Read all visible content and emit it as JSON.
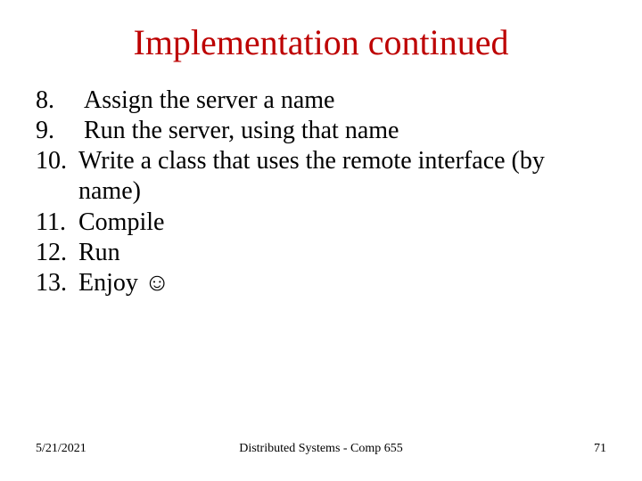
{
  "title": "Implementation continued",
  "items": [
    {
      "n": "8.",
      "text": "Assign the server a name",
      "tight": false
    },
    {
      "n": "9.",
      "text": "Run the server, using that name",
      "tight": false
    },
    {
      "n": "10.",
      "text": "Write a class that uses the remote interface (by name)",
      "tight": true
    },
    {
      "n": "11.",
      "text": "Compile",
      "tight": true
    },
    {
      "n": "12.",
      "text": "Run",
      "tight": true
    },
    {
      "n": "13.",
      "text": "Enjoy ☺",
      "tight": true
    }
  ],
  "footer": {
    "date": "5/21/2021",
    "center": "Distributed Systems - Comp 655",
    "page": "71"
  }
}
